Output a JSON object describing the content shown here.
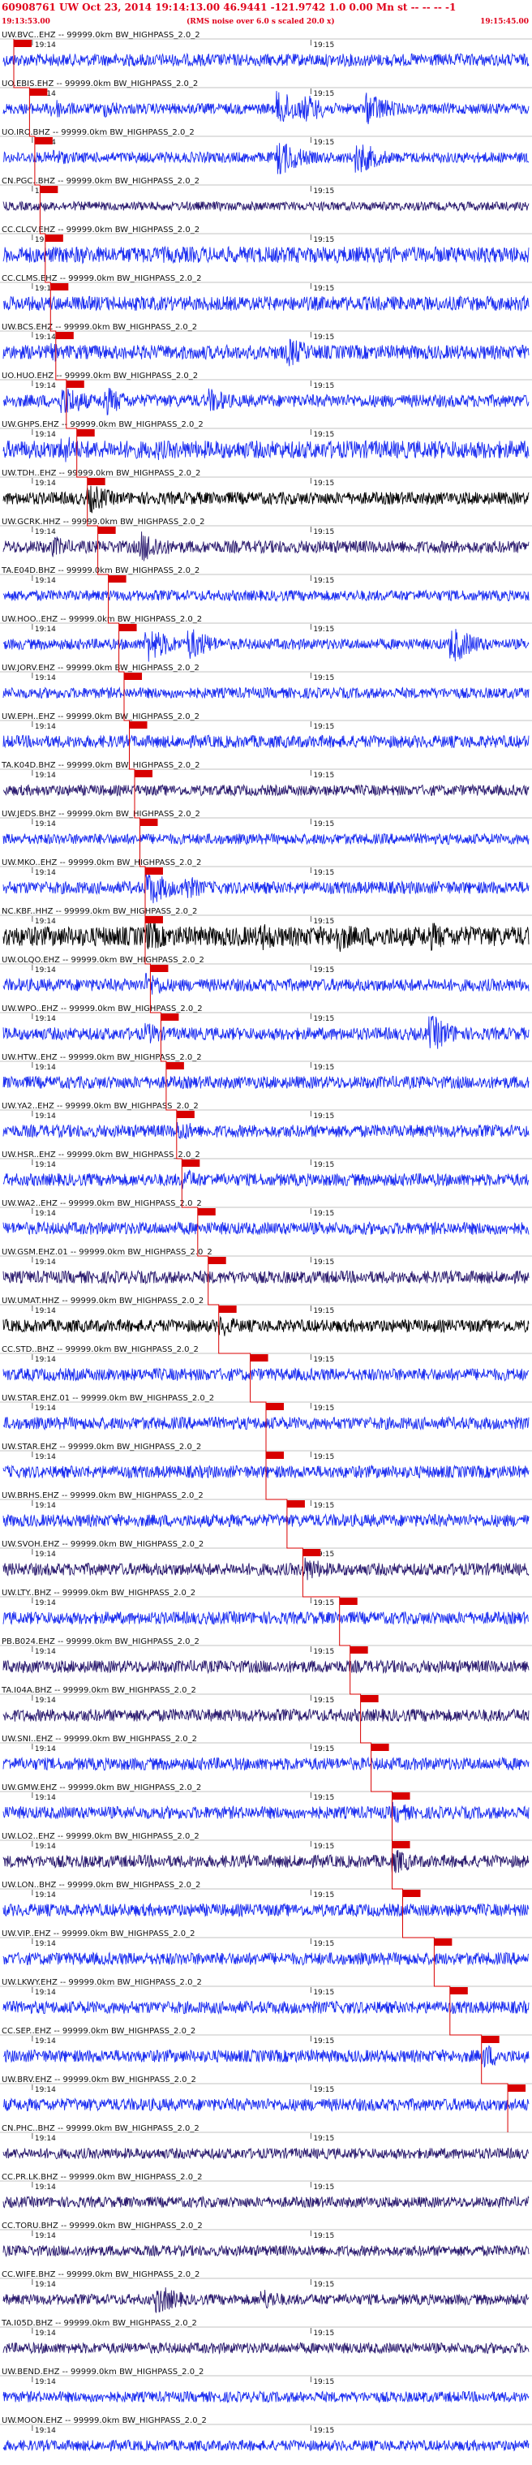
{
  "header": {
    "event_line": "60908761 UW Oct 23, 2014 19:14:13.00   46.9441 -121.9742  1.0 0.00 Mn st -- -- -- -1",
    "rms_note": "(RMS noise over 6.0 s scaled 20.0 x)",
    "start_time": "19:13:53.00",
    "end_time": "19:15:45.00"
  },
  "colors": {
    "header_text": "#e0001a",
    "pick_marker": "#d80000",
    "trace_blue": "#1a2cf0",
    "trace_purple": "#2a1a6e",
    "trace_black": "#000000",
    "axis_text": "#111111"
  },
  "chart_data": {
    "type": "line",
    "description_of_axes": "time axis runs from start_time to end_time; each channel is an independent waveform trace",
    "time_ticks": [
      "19:14",
      "19:15"
    ],
    "traces": [
      {
        "label": "UW.BVC..EHZ -- 99999.0km BW_HIGHPASS_2.0_2",
        "color": "blue",
        "amp": 0.35,
        "pick": 0.02,
        "bursts": []
      },
      {
        "label": "UO.EBIS.EHZ -- 99999.0km BW_HIGHPASS_2.0_2",
        "color": "blue",
        "amp": 0.3,
        "pick": 0.05,
        "bursts": [
          [
            0.1,
            0.6
          ],
          [
            0.2,
            0.5
          ],
          [
            0.53,
            1.0
          ],
          [
            0.58,
            0.8
          ],
          [
            0.7,
            0.9
          ]
        ]
      },
      {
        "label": "UO.IRO.BHZ -- 99999.0km BW_HIGHPASS_2.0_2",
        "color": "blue",
        "amp": 0.3,
        "pick": 0.06,
        "bursts": [
          [
            0.1,
            0.5
          ],
          [
            0.53,
            1.0
          ],
          [
            0.68,
            0.9
          ]
        ]
      },
      {
        "label": "CN.PGC..BHZ -- 99999.0km BW_HIGHPASS_2.0_2",
        "color": "purple",
        "amp": 0.25,
        "pick": 0.07,
        "bursts": []
      },
      {
        "label": "CC.CLCV.EHZ -- 99999.0km BW_HIGHPASS_2.0_2",
        "color": "blue",
        "amp": 0.45,
        "pick": 0.08,
        "bursts": [
          [
            0.15,
            0.5
          ]
        ]
      },
      {
        "label": "CC.CLMS.EHZ -- 99999.0km BW_HIGHPASS_2.0_2",
        "color": "blue",
        "amp": 0.4,
        "pick": 0.09,
        "bursts": []
      },
      {
        "label": "UW.BCS.EHZ -- 99999.0km BW_HIGHPASS_2.0_2",
        "color": "blue",
        "amp": 0.4,
        "pick": 0.1,
        "bursts": [
          [
            0.1,
            0.5
          ],
          [
            0.55,
            0.8
          ]
        ]
      },
      {
        "label": "UO.HUO.EHZ -- 99999.0km BW_HIGHPASS_2.0_2",
        "color": "blue",
        "amp": 0.35,
        "pick": 0.12,
        "bursts": [
          [
            0.12,
            0.9
          ],
          [
            0.2,
            0.8
          ],
          [
            0.4,
            0.7
          ]
        ]
      },
      {
        "label": "UW.GHPS.EHZ -- 99999.0km BW_HIGHPASS_2.0_2",
        "color": "blue",
        "amp": 0.5,
        "pick": 0.14,
        "bursts": [
          [
            0.12,
            0.8
          ],
          [
            0.3,
            0.6
          ]
        ]
      },
      {
        "label": "UW.TDH..EHZ -- 99999.0km BW_HIGHPASS_2.0_2",
        "color": "black",
        "amp": 0.35,
        "pick": 0.16,
        "bursts": [
          [
            0.17,
            0.8
          ]
        ]
      },
      {
        "label": "UW.GCRK.HHZ -- 99999.0km BW_HIGHPASS_2.0_2",
        "color": "purple",
        "amp": 0.35,
        "pick": 0.18,
        "bursts": [
          [
            0.1,
            0.6
          ],
          [
            0.27,
            0.9
          ]
        ]
      },
      {
        "label": "TA.E04D.BHZ -- 99999.0km BW_HIGHPASS_2.0_2",
        "color": "blue",
        "amp": 0.3,
        "pick": 0.2,
        "bursts": []
      },
      {
        "label": "UW.HOO..EHZ -- 99999.0km BW_HIGHPASS_2.0_2",
        "color": "blue",
        "amp": 0.3,
        "pick": 0.22,
        "bursts": [
          [
            0.28,
            1.0
          ],
          [
            0.36,
            0.9
          ],
          [
            0.86,
            1.0
          ]
        ]
      },
      {
        "label": "UW.JORV.EHZ -- 99999.0km BW_HIGHPASS_2.0_2",
        "color": "blue",
        "amp": 0.3,
        "pick": 0.23,
        "bursts": []
      },
      {
        "label": "UW.EPH..EHZ -- 99999.0km BW_HIGHPASS_2.0_2",
        "color": "blue",
        "amp": 0.35,
        "pick": 0.24,
        "bursts": []
      },
      {
        "label": "TA.K04D.BHZ -- 99999.0km BW_HIGHPASS_2.0_2",
        "color": "purple",
        "amp": 0.3,
        "pick": 0.25,
        "bursts": []
      },
      {
        "label": "UW.JEDS.BHZ -- 99999.0km BW_HIGHPASS_2.0_2",
        "color": "blue",
        "amp": 0.3,
        "pick": 0.26,
        "bursts": []
      },
      {
        "label": "UW.MKO..EHZ -- 99999.0km BW_HIGHPASS_2.0_2",
        "color": "blue",
        "amp": 0.35,
        "pick": 0.27,
        "bursts": [
          [
            0.28,
            1.0
          ],
          [
            0.35,
            0.7
          ]
        ]
      },
      {
        "label": "NC.KBF..HHZ -- 99999.0km BW_HIGHPASS_2.0_2",
        "color": "black",
        "amp": 0.55,
        "pick": 0.27,
        "bursts": [
          [
            0.28,
            0.9
          ],
          [
            0.5,
            0.8
          ],
          [
            0.64,
            0.9
          ],
          [
            0.82,
            0.8
          ]
        ]
      },
      {
        "label": "UW.OLQO.EHZ -- 99999.0km BW_HIGHPASS_2.0_2",
        "color": "blue",
        "amp": 0.35,
        "pick": 0.28,
        "bursts": [
          [
            0.28,
            0.7
          ]
        ]
      },
      {
        "label": "UW.WPO..EHZ -- 99999.0km BW_HIGHPASS_2.0_2",
        "color": "blue",
        "amp": 0.35,
        "pick": 0.3,
        "bursts": [
          [
            0.28,
            0.6
          ],
          [
            0.82,
            1.0
          ]
        ]
      },
      {
        "label": "UW.HTW..EHZ -- 99999.0km BW_HIGHPASS_2.0_2",
        "color": "blue",
        "amp": 0.35,
        "pick": 0.31,
        "bursts": []
      },
      {
        "label": "UW.YA2..EHZ -- 99999.0km BW_HIGHPASS_2.0_2",
        "color": "blue",
        "amp": 0.35,
        "pick": 0.33,
        "bursts": [
          [
            0.34,
            0.6
          ]
        ]
      },
      {
        "label": "UW.HSR..EHZ -- 99999.0km BW_HIGHPASS_2.0_2",
        "color": "blue",
        "amp": 0.35,
        "pick": 0.34,
        "bursts": [
          [
            0.35,
            0.6
          ]
        ]
      },
      {
        "label": "UW.WA2..EHZ -- 99999.0km BW_HIGHPASS_2.0_2",
        "color": "blue",
        "amp": 0.35,
        "pick": 0.37,
        "bursts": []
      },
      {
        "label": "UW.GSM.EHZ.01 -- 99999.0km BW_HIGHPASS_2.0_2",
        "color": "purple",
        "amp": 0.35,
        "pick": 0.39,
        "bursts": []
      },
      {
        "label": "UW.UMAT.HHZ -- 99999.0km BW_HIGHPASS_2.0_2",
        "color": "black",
        "amp": 0.35,
        "pick": 0.41,
        "bursts": [
          [
            0.42,
            0.6
          ]
        ]
      },
      {
        "label": "CC.STD..BHZ -- 99999.0km BW_HIGHPASS_2.0_2",
        "color": "blue",
        "amp": 0.35,
        "pick": 0.47,
        "bursts": []
      },
      {
        "label": "UW.STAR.EHZ.01 -- 99999.0km BW_HIGHPASS_2.0_2",
        "color": "blue",
        "amp": 0.35,
        "pick": 0.5,
        "bursts": []
      },
      {
        "label": "UW.STAR.EHZ -- 99999.0km BW_HIGHPASS_2.0_2",
        "color": "blue",
        "amp": 0.35,
        "pick": 0.5,
        "bursts": []
      },
      {
        "label": "UW.BRHS.EHZ -- 99999.0km BW_HIGHPASS_2.0_2",
        "color": "blue",
        "amp": 0.35,
        "pick": 0.54,
        "bursts": []
      },
      {
        "label": "UW.SVOH.EHZ -- 99999.0km BW_HIGHPASS_2.0_2",
        "color": "purple",
        "amp": 0.35,
        "pick": 0.57,
        "bursts": [
          [
            0.58,
            0.7
          ]
        ]
      },
      {
        "label": "UW.LTY..BHZ -- 99999.0km BW_HIGHPASS_2.0_2",
        "color": "blue",
        "amp": 0.35,
        "pick": 0.64,
        "bursts": []
      },
      {
        "label": "PB.B024.EHZ -- 99999.0km BW_HIGHPASS_2.0_2",
        "color": "purple",
        "amp": 0.35,
        "pick": 0.66,
        "bursts": []
      },
      {
        "label": "TA.I04A.BHZ -- 99999.0km BW_HIGHPASS_2.0_2",
        "color": "purple",
        "amp": 0.35,
        "pick": 0.68,
        "bursts": []
      },
      {
        "label": "UW.SNI..EHZ -- 99999.0km BW_HIGHPASS_2.0_2",
        "color": "blue",
        "amp": 0.35,
        "pick": 0.7,
        "bursts": []
      },
      {
        "label": "UW.GMW.EHZ -- 99999.0km BW_HIGHPASS_2.0_2",
        "color": "blue",
        "amp": 0.35,
        "pick": 0.74,
        "bursts": [
          [
            0.75,
            0.6
          ]
        ]
      },
      {
        "label": "UW.LO2..EHZ -- 99999.0km BW_HIGHPASS_2.0_2",
        "color": "purple",
        "amp": 0.35,
        "pick": 0.74,
        "bursts": [
          [
            0.75,
            0.7
          ]
        ]
      },
      {
        "label": "UW.LON..BHZ -- 99999.0km BW_HIGHPASS_2.0_2",
        "color": "blue",
        "amp": 0.35,
        "pick": 0.76,
        "bursts": []
      },
      {
        "label": "UW.VIP..EHZ -- 99999.0km BW_HIGHPASS_2.0_2",
        "color": "blue",
        "amp": 0.35,
        "pick": 0.82,
        "bursts": []
      },
      {
        "label": "UW.LKWY.EHZ -- 99999.0km BW_HIGHPASS_2.0_2",
        "color": "blue",
        "amp": 0.35,
        "pick": 0.85,
        "bursts": []
      },
      {
        "label": "CC.SEP..EHZ -- 99999.0km BW_HIGHPASS_2.0_2",
        "color": "blue",
        "amp": 0.35,
        "pick": 0.91,
        "bursts": [
          [
            0.92,
            0.7
          ]
        ]
      },
      {
        "label": "UW.BRV.EHZ -- 99999.0km BW_HIGHPASS_2.0_2",
        "color": "blue",
        "amp": 0.35,
        "pick": 0.96,
        "bursts": []
      },
      {
        "label": "CN.PHC..BHZ -- 99999.0km BW_HIGHPASS_2.0_2",
        "color": "purple",
        "amp": 0.3,
        "pick": null,
        "bursts": []
      },
      {
        "label": "CC.PR.LK.BHZ -- 99999.0km BW_HIGHPASS_2.0_2",
        "color": "purple",
        "amp": 0.3,
        "pick": null,
        "bursts": []
      },
      {
        "label": "CC.TORU.BHZ -- 99999.0km BW_HIGHPASS_2.0_2",
        "color": "purple",
        "amp": 0.3,
        "pick": null,
        "bursts": []
      },
      {
        "label": "CC.WIFE.BHZ -- 99999.0km BW_HIGHPASS_2.0_2",
        "color": "purple",
        "amp": 0.3,
        "pick": null,
        "bursts": [
          [
            0.3,
            0.8
          ],
          [
            0.5,
            0.6
          ]
        ]
      },
      {
        "label": "TA.I05D.BHZ -- 99999.0km BW_HIGHPASS_2.0_2",
        "color": "purple",
        "amp": 0.3,
        "pick": null,
        "bursts": []
      },
      {
        "label": "UW.BEND.EHZ -- 99999.0km BW_HIGHPASS_2.0_2",
        "color": "blue",
        "amp": 0.3,
        "pick": null,
        "bursts": []
      },
      {
        "label": "UW.MOON.EHZ -- 99999.0km BW_HIGHPASS_2.0_2",
        "color": "blue",
        "amp": 0.3,
        "pick": null,
        "bursts": []
      }
    ]
  }
}
